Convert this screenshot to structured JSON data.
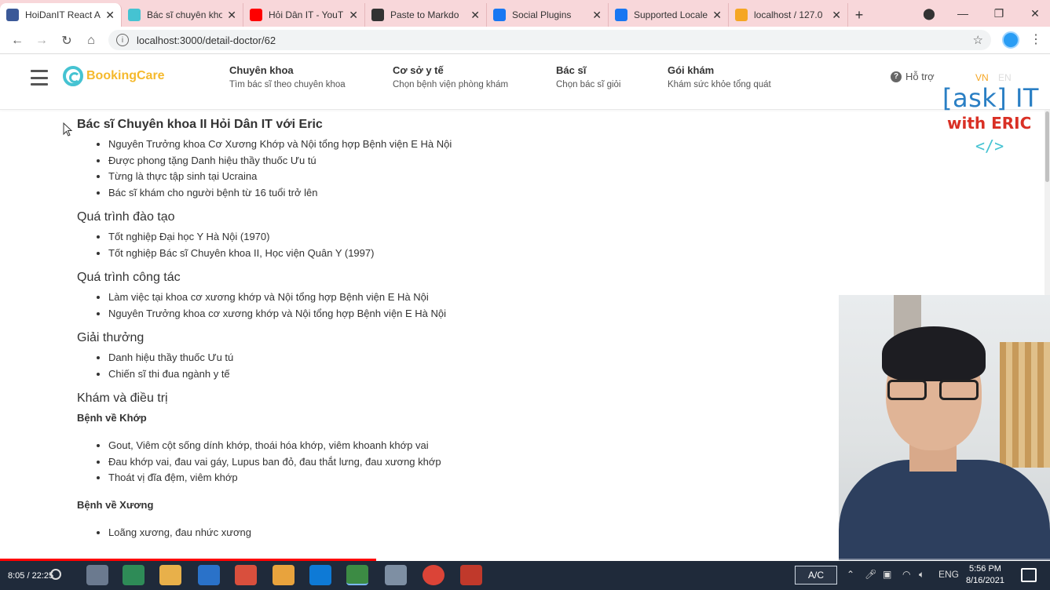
{
  "browser": {
    "tabs": [
      {
        "title": "HoiDanIT React A",
        "favicon_color": "#3b5998",
        "active": true
      },
      {
        "title": "Bác sĩ chuyên kho",
        "favicon_color": "#45c3d2"
      },
      {
        "title": "Hỏi Dân IT - YouT",
        "favicon_color": "#ff0000"
      },
      {
        "title": "Paste to Markdo",
        "favicon_color": "#333333"
      },
      {
        "title": "Social Plugins",
        "favicon_color": "#1877f2"
      },
      {
        "title": "Supported Locale",
        "favicon_color": "#1877f2"
      },
      {
        "title": "localhost / 127.0",
        "favicon_color": "#f5a623"
      }
    ],
    "new_tab_label": "+",
    "url": "localhost:3000/detail-doctor/62"
  },
  "site": {
    "logo_text": "BookingCare",
    "menu": [
      {
        "title": "Chuyên khoa",
        "subtitle": "Tìm bác sĩ theo chuyên khoa"
      },
      {
        "title": "Cơ sở y tế",
        "subtitle": "Chọn bệnh viện phòng khám"
      },
      {
        "title": "Bác sĩ",
        "subtitle": "Chọn bác sĩ giỏi"
      },
      {
        "title": "Gói khám",
        "subtitle": "Khám sức khỏe tổng quát"
      }
    ],
    "support_label": "Hỗ trợ",
    "lang_vn": "VN",
    "lang_en": "EN"
  },
  "watermark": {
    "line1": "[ask] IT",
    "line2": "with ERIC",
    "line3": "</>"
  },
  "doctor": {
    "title": "Bác sĩ Chuyên khoa II Hỏi Dân IT với Eric",
    "intro": [
      "Nguyên Trưởng khoa Cơ Xương Khớp và Nội tổng hợp Bệnh viện E Hà Nội",
      "Được phong tặng Danh hiệu thầy thuốc Ưu tú",
      "Từng là thực tập sinh tại Ucraina",
      "Bác sĩ khám cho người bệnh từ 16 tuổi trở lên"
    ],
    "training_heading": "Quá trình đào tạo",
    "training": [
      "Tốt nghiệp Đại học Y Hà Nội (1970)",
      "Tốt nghiệp Bác sĩ Chuyên khoa II, Học viện Quân Y (1997)"
    ],
    "work_heading": "Quá trình công tác",
    "work": [
      "Làm việc tại khoa cơ xương khớp và Nội tổng hợp Bệnh viện E Hà Nội",
      "Nguyên Trưởng khoa cơ xương khớp và Nội tổng hợp Bệnh viện E Hà Nội"
    ],
    "awards_heading": "Giải thưởng",
    "awards": [
      "Danh hiệu thầy thuốc Ưu tú",
      "Chiến sĩ thi đua ngành y tế"
    ],
    "treatment_heading": "Khám và điều trị",
    "joint_heading": "Bệnh về Khớp",
    "joint": [
      "Gout, Viêm cột sống dính khớp, thoái hóa khớp, viêm khoanh khớp vai",
      "Đau khớp vai, đau vai gáy, Lupus ban đỏ, đau thắt lưng, đau xương khớp",
      "Thoát vị đĩa đệm, viêm khớp"
    ],
    "bone_heading": "Bệnh về Xương",
    "bone": [
      "Loãng xương, đau nhức xương"
    ]
  },
  "video": {
    "time": "8:05 / 22:25",
    "progress": 0.358
  },
  "taskbar": {
    "ac_label": "A/C",
    "lang": "ENG",
    "time": "5:56 PM",
    "date": "8/16/2021"
  }
}
